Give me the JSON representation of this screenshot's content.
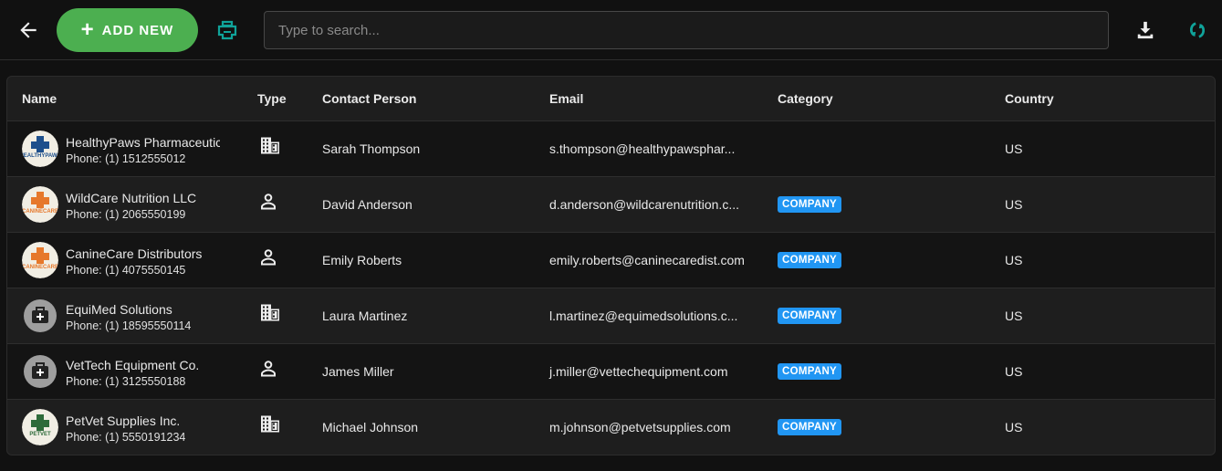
{
  "toolbar": {
    "add_label": "ADD NEW",
    "search_placeholder": "Type to search...",
    "accent": "#4caf50",
    "icon_accent": "#10a39a"
  },
  "table": {
    "headers": {
      "name": "Name",
      "type": "Type",
      "contact": "Contact Person",
      "email": "Email",
      "category": "Category",
      "country": "Country"
    },
    "rows": [
      {
        "name": "HealthyPaws Pharmaceuticals",
        "phone": "Phone: (1) 1512555012",
        "logo": "HEALTHYPAWS",
        "type": "building-icon",
        "contact": "Sarah Thompson",
        "email": "s.thompson@healthypawsphar...",
        "category": "",
        "country": "US"
      },
      {
        "name": "WildCare Nutrition LLC",
        "phone": "Phone: (1) 2065550199",
        "logo": "CANINECARE",
        "type": "person-icon",
        "contact": "David Anderson",
        "email": "d.anderson@wildcarenutrition.c...",
        "category": "COMPANY",
        "country": "US"
      },
      {
        "name": "CanineCare Distributors",
        "phone": "Phone: (1) 4075550145",
        "logo": "CANINECARE",
        "type": "person-icon",
        "contact": "Emily Roberts",
        "email": "emily.roberts@caninecaredist.com",
        "category": "COMPANY",
        "country": "US"
      },
      {
        "name": "EquiMed Solutions",
        "phone": "Phone: (1) 18595550114",
        "logo": "",
        "type": "building-icon",
        "contact": "Laura Martinez",
        "email": "l.martinez@equimedsolutions.c...",
        "category": "COMPANY",
        "country": "US"
      },
      {
        "name": "VetTech Equipment Co.",
        "phone": "Phone: (1) 3125550188",
        "logo": "",
        "type": "person-icon",
        "contact": "James Miller",
        "email": "j.miller@vettechequipment.com",
        "category": "COMPANY",
        "country": "US"
      },
      {
        "name": "PetVet Supplies Inc.",
        "phone": "Phone: (1) 5550191234",
        "logo": "PETVET",
        "type": "building-icon",
        "contact": "Michael Johnson",
        "email": "m.johnson@petvetsupplies.com",
        "category": "COMPANY",
        "country": "US"
      }
    ]
  }
}
